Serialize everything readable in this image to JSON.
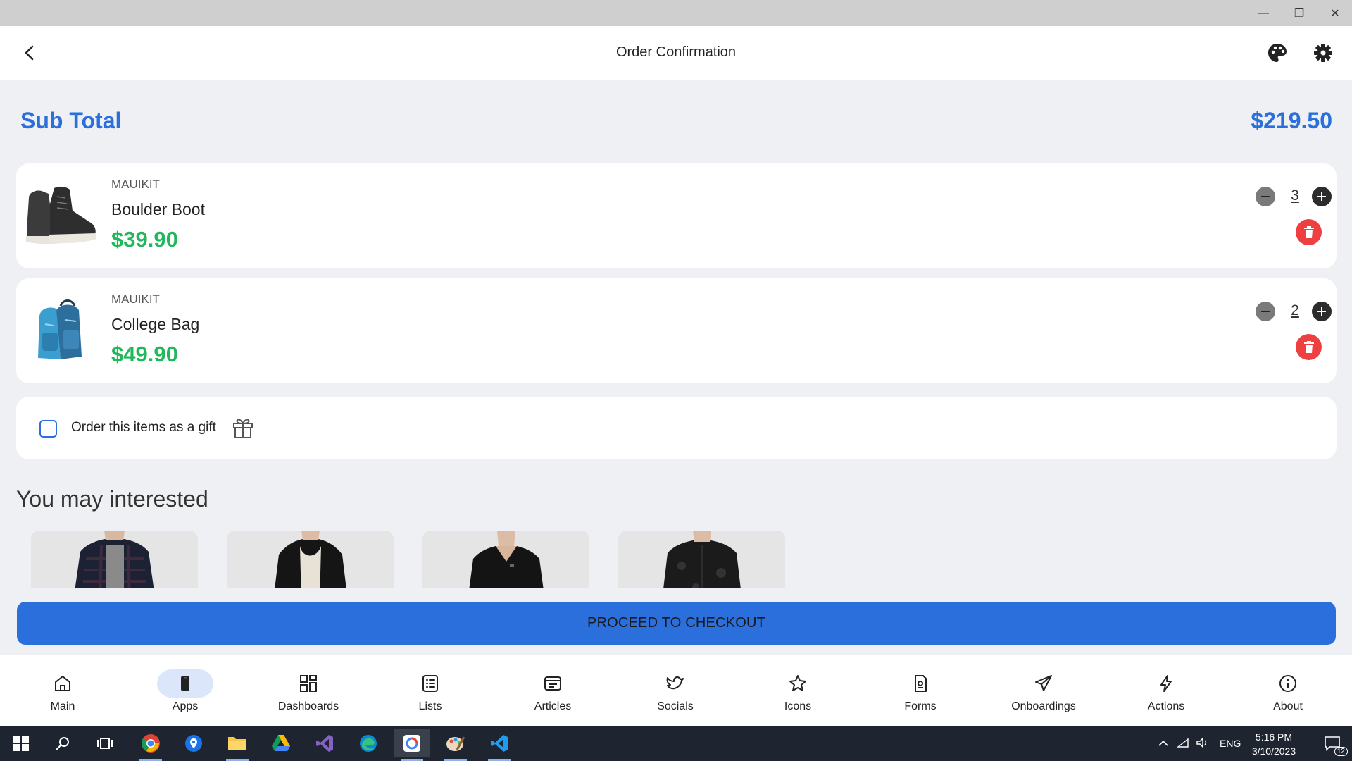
{
  "window": {
    "minimize_glyph": "—",
    "maximize_glyph": "❐",
    "close_glyph": "✕"
  },
  "header": {
    "title": "Order Confirmation",
    "back_icon": "chevron-left-icon",
    "palette_icon": "palette-icon",
    "settings_icon": "gear-icon"
  },
  "subtotal": {
    "label": "Sub Total",
    "value": "$219.50"
  },
  "cart": {
    "items": [
      {
        "brand": "MAUIKIT",
        "name": "Boulder Boot",
        "price": "$39.90",
        "quantity": "3",
        "image": "boot-image"
      },
      {
        "brand": "MAUIKIT",
        "name": "College Bag",
        "price": "$49.90",
        "quantity": "2",
        "image": "backpack-image"
      }
    ]
  },
  "gift": {
    "label": "Order this items as a gift",
    "checked": false
  },
  "interested": {
    "title": "You may interested",
    "products": [
      "flannel-shirt-image",
      "hooded-jacket-image",
      "black-sweater-image",
      "patterned-shirt-image"
    ]
  },
  "checkout": {
    "label": "PROCEED TO CHECKOUT"
  },
  "nav": {
    "items": [
      {
        "label": "Main",
        "icon": "home-icon",
        "active": false
      },
      {
        "label": "Apps",
        "icon": "phone-icon",
        "active": true
      },
      {
        "label": "Dashboards",
        "icon": "dashboard-icon",
        "active": false
      },
      {
        "label": "Lists",
        "icon": "list-icon",
        "active": false
      },
      {
        "label": "Articles",
        "icon": "article-icon",
        "active": false
      },
      {
        "label": "Socials",
        "icon": "twitter-icon",
        "active": false
      },
      {
        "label": "Icons",
        "icon": "star-icon",
        "active": false
      },
      {
        "label": "Forms",
        "icon": "form-icon",
        "active": false
      },
      {
        "label": "Onboardings",
        "icon": "paper-plane-icon",
        "active": false
      },
      {
        "label": "Actions",
        "icon": "lightning-icon",
        "active": false
      },
      {
        "label": "About",
        "icon": "info-icon",
        "active": false
      }
    ]
  },
  "taskbar": {
    "language": "ENG",
    "time": "5:16 PM",
    "date": "3/10/2023",
    "notification_count": "12"
  },
  "colors": {
    "accent": "#2b6fdc",
    "price_green": "#1fb85a",
    "delete_red": "#ee4040"
  }
}
